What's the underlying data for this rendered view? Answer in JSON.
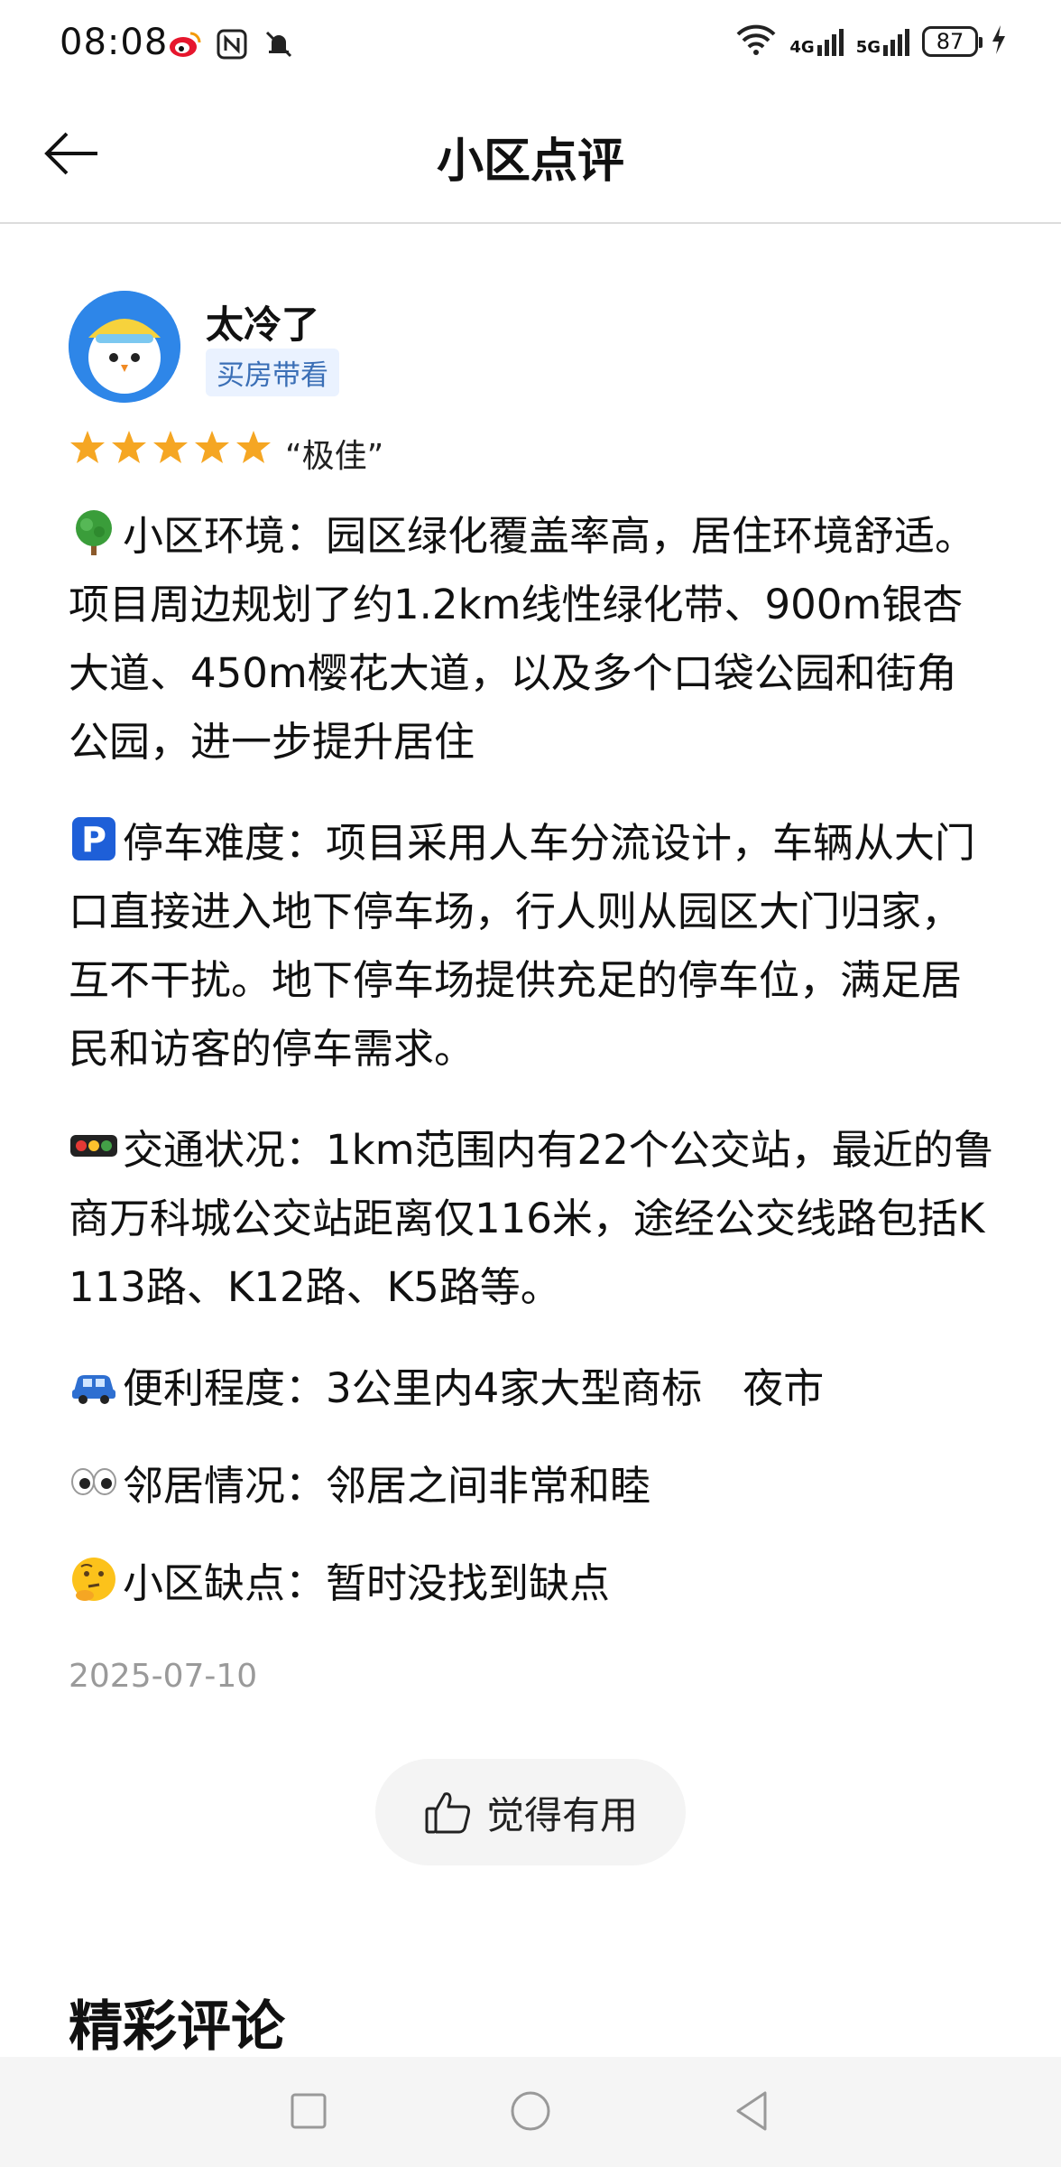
{
  "status_bar": {
    "time": "08:08",
    "icons_left": [
      "weibo-icon",
      "nfc-icon",
      "mute-icon"
    ],
    "network_1": "4G",
    "network_2": "5G",
    "battery": "87"
  },
  "header": {
    "title": "小区点评"
  },
  "review": {
    "user_name": "太冷了",
    "user_tag": "买房带看",
    "rating_stars": 5,
    "rating_text": "“极佳”",
    "paragraphs": {
      "environment": "小区环境：园区绿化覆盖率高，居住环境舒适。项目周边规划了约1.2km线性绿化带、900m银杏大道、450m樱花大道，以及多个口袋公园和街角公园，进一步提升居住",
      "parking": "停车难度：项目采用人车分流设计，车辆从大门口直接进入地下停车场，行人则从园区大门归家，互不干扰。地下停车场提供充足的停车位，满足居民和访客的停车需求。",
      "traffic": "交通状况：1km范围内有22个公交站，最近的鲁商万科城公交站距离仅116米，途经公交线路包括K113路、K12路、K5路等。",
      "convenience": "便利程度：3公里内4家大型商标　夜市",
      "neighbors": "邻居情况：邻居之间非常和睦",
      "drawbacks": "小区缺点：暂时没找到缺点"
    },
    "date": "2025-07-10",
    "useful_label": "觉得有用"
  },
  "comments_section": {
    "title": "精彩评论"
  },
  "colors": {
    "tag_bg": "#eaf2ff",
    "tag_text": "#3b6fb6",
    "star": "#f5a623",
    "avatar_bg": "#2e86e8"
  }
}
